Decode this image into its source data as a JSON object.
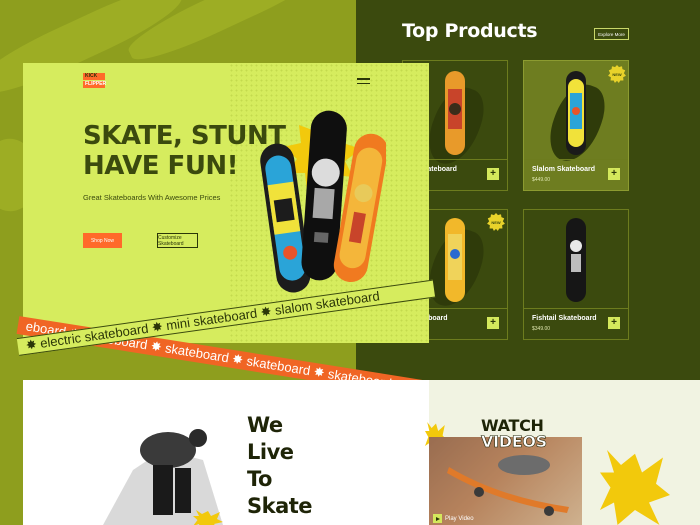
{
  "brand": {
    "logo_line1": "KICK",
    "logo_line2": "FLIPPER"
  },
  "hero": {
    "headline_line1": "SKATE, STUNT",
    "headline_line2": "HAVE FUN!",
    "subtitle": "Great Skateboards With Awesome Prices",
    "shop_button": "Shop Now",
    "customize_button": "Customize Skateboard"
  },
  "ribbons": {
    "orange_text": "eboard ✸ skateboard ✸ skateboard ✸ skateboard ✸ skateboard",
    "lime_text": "✸ electric skateboard ✸ mini skateboard ✸ slalom skateboard"
  },
  "top_products": {
    "title": "Top Products",
    "explore_label": "Explore More",
    "cards": [
      {
        "name": "ic Skateboard",
        "price": "",
        "badge": ""
      },
      {
        "name": "Slalom Skateboard",
        "price": "$449.00",
        "badge": "NEW"
      },
      {
        "name": "Longboard",
        "price": "",
        "badge": "NEW"
      },
      {
        "name": "Fishtail Skateboard",
        "price": "$349.00",
        "badge": ""
      }
    ],
    "plus_label": "+"
  },
  "about": {
    "line1": "We",
    "line2": "Live",
    "line3": "To",
    "line4": "Skate"
  },
  "videos": {
    "title_line1": "WATCH",
    "title_line2": "VIDEOS",
    "play_label": "Play Video"
  },
  "colors": {
    "lime": "#d6ec5e",
    "dark_olive": "#3b4a0e",
    "orange": "#f06524",
    "yellow": "#e8d22a",
    "bg_olive": "#8e9e1e"
  }
}
